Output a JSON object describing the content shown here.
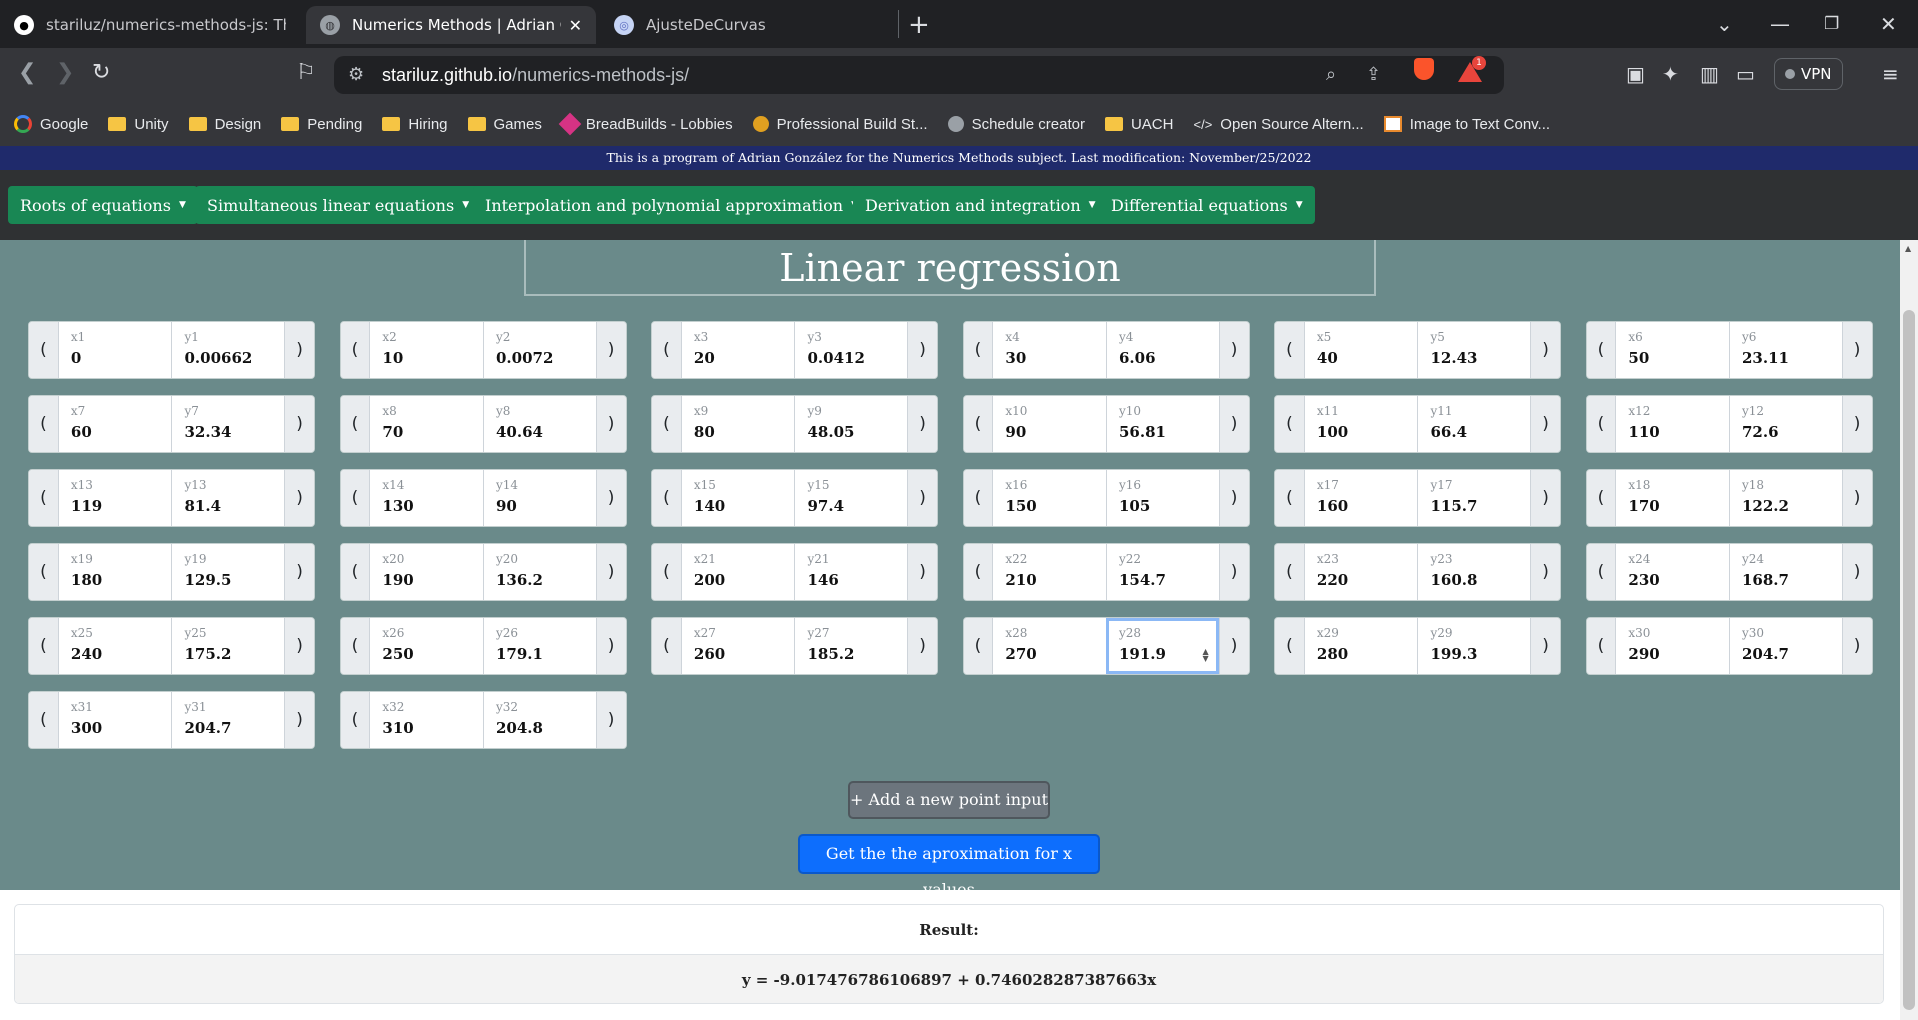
{
  "browser": {
    "tabs": [
      {
        "title": "stariluz/numerics-methods-js: Thesc",
        "icon": "github-icon"
      },
      {
        "title": "Numerics Methods | Adrian Go",
        "icon": "globe-icon",
        "active": true
      },
      {
        "title": "AjusteDeCurvas",
        "icon": "colab-icon"
      }
    ],
    "new_tab": "+",
    "url_host": "stariluz.github.io",
    "url_path": "/numerics-methods-js/",
    "vpn_label": "VPN",
    "alert_count": "1",
    "bookmarks": [
      {
        "label": "Google",
        "icon": "google"
      },
      {
        "label": "Unity",
        "icon": "folder"
      },
      {
        "label": "Design",
        "icon": "folder"
      },
      {
        "label": "Pending",
        "icon": "folder"
      },
      {
        "label": "Hiring",
        "icon": "folder"
      },
      {
        "label": "Games",
        "icon": "folder"
      },
      {
        "label": "BreadBuilds - Lobbies",
        "icon": "breadbuilds"
      },
      {
        "label": "Professional Build St...",
        "icon": "probuild"
      },
      {
        "label": "Schedule creator",
        "icon": "globe"
      },
      {
        "label": "UACH",
        "icon": "folder"
      },
      {
        "label": "Open Source Altern...",
        "icon": "code"
      },
      {
        "label": "Image to Text Conv...",
        "icon": "image"
      }
    ]
  },
  "page": {
    "banner": "This is a program of Adrian González for the Numerics Methods subject. Last modification: November/25/2022",
    "menus": [
      "Roots of equations",
      "Simultaneous linear equations",
      "Interpolation and polynomial approximation",
      "Derivation and integration",
      "Differential equations"
    ],
    "title": "Linear regression",
    "points": [
      {
        "xl": "x1",
        "x": "0",
        "yl": "y1",
        "y": "0.00662"
      },
      {
        "xl": "x2",
        "x": "10",
        "yl": "y2",
        "y": "0.0072"
      },
      {
        "xl": "x3",
        "x": "20",
        "yl": "y3",
        "y": "0.0412"
      },
      {
        "xl": "x4",
        "x": "30",
        "yl": "y4",
        "y": "6.06"
      },
      {
        "xl": "x5",
        "x": "40",
        "yl": "y5",
        "y": "12.43"
      },
      {
        "xl": "x6",
        "x": "50",
        "yl": "y6",
        "y": "23.11"
      },
      {
        "xl": "x7",
        "x": "60",
        "yl": "y7",
        "y": "32.34"
      },
      {
        "xl": "x8",
        "x": "70",
        "yl": "y8",
        "y": "40.64"
      },
      {
        "xl": "x9",
        "x": "80",
        "yl": "y9",
        "y": "48.05"
      },
      {
        "xl": "x10",
        "x": "90",
        "yl": "y10",
        "y": "56.81"
      },
      {
        "xl": "x11",
        "x": "100",
        "yl": "y11",
        "y": "66.4"
      },
      {
        "xl": "x12",
        "x": "110",
        "yl": "y12",
        "y": "72.6"
      },
      {
        "xl": "x13",
        "x": "119",
        "yl": "y13",
        "y": "81.4"
      },
      {
        "xl": "x14",
        "x": "130",
        "yl": "y14",
        "y": "90"
      },
      {
        "xl": "x15",
        "x": "140",
        "yl": "y15",
        "y": "97.4"
      },
      {
        "xl": "x16",
        "x": "150",
        "yl": "y16",
        "y": "105"
      },
      {
        "xl": "x17",
        "x": "160",
        "yl": "y17",
        "y": "115.7"
      },
      {
        "xl": "x18",
        "x": "170",
        "yl": "y18",
        "y": "122.2"
      },
      {
        "xl": "x19",
        "x": "180",
        "yl": "y19",
        "y": "129.5"
      },
      {
        "xl": "x20",
        "x": "190",
        "yl": "y20",
        "y": "136.2"
      },
      {
        "xl": "x21",
        "x": "200",
        "yl": "y21",
        "y": "146"
      },
      {
        "xl": "x22",
        "x": "210",
        "yl": "y22",
        "y": "154.7"
      },
      {
        "xl": "x23",
        "x": "220",
        "yl": "y23",
        "y": "160.8"
      },
      {
        "xl": "x24",
        "x": "230",
        "yl": "y24",
        "y": "168.7"
      },
      {
        "xl": "x25",
        "x": "240",
        "yl": "y25",
        "y": "175.2"
      },
      {
        "xl": "x26",
        "x": "250",
        "yl": "y26",
        "y": "179.1"
      },
      {
        "xl": "x27",
        "x": "260",
        "yl": "y27",
        "y": "185.2"
      },
      {
        "xl": "x28",
        "x": "270",
        "yl": "y28",
        "y": "191.9",
        "y_focused": true
      },
      {
        "xl": "x29",
        "x": "280",
        "yl": "y29",
        "y": "199.3"
      },
      {
        "xl": "x30",
        "x": "290",
        "yl": "y30",
        "y": "204.7"
      },
      {
        "xl": "x31",
        "x": "300",
        "yl": "y31",
        "y": "204.7"
      },
      {
        "xl": "x32",
        "x": "310",
        "yl": "y32",
        "y": "204.8"
      }
    ],
    "add_button": "+ Add a new point input",
    "get_button": "Get the the aproximation for x values",
    "result_label": "Result:",
    "result_value": "y = -9.017476786106897 + 0.746028287387663x"
  }
}
